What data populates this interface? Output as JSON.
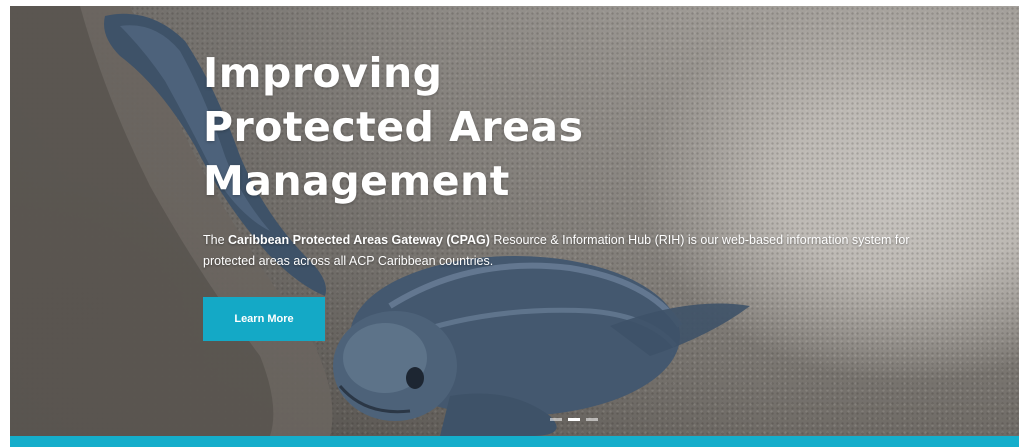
{
  "hero": {
    "headline_lines": [
      "Improving",
      "Protected Areas",
      "Management"
    ],
    "description": {
      "prefix": "The ",
      "bold": "Caribbean Protected Areas Gateway (CPAG)",
      "suffix": " Resource & Information Hub (RIH) is our web-based information system for protected areas across all ACP Caribbean countries."
    },
    "cta_label": "Learn More",
    "slider": {
      "slide_count": 3,
      "active_index": 1
    }
  },
  "colors": {
    "accent": "#14a9c6",
    "bottom_bar": "#15aecb",
    "headline_text": "#ffffff"
  },
  "icons": {
    "background_image": "sea-turtle-hatchling-on-sand"
  }
}
